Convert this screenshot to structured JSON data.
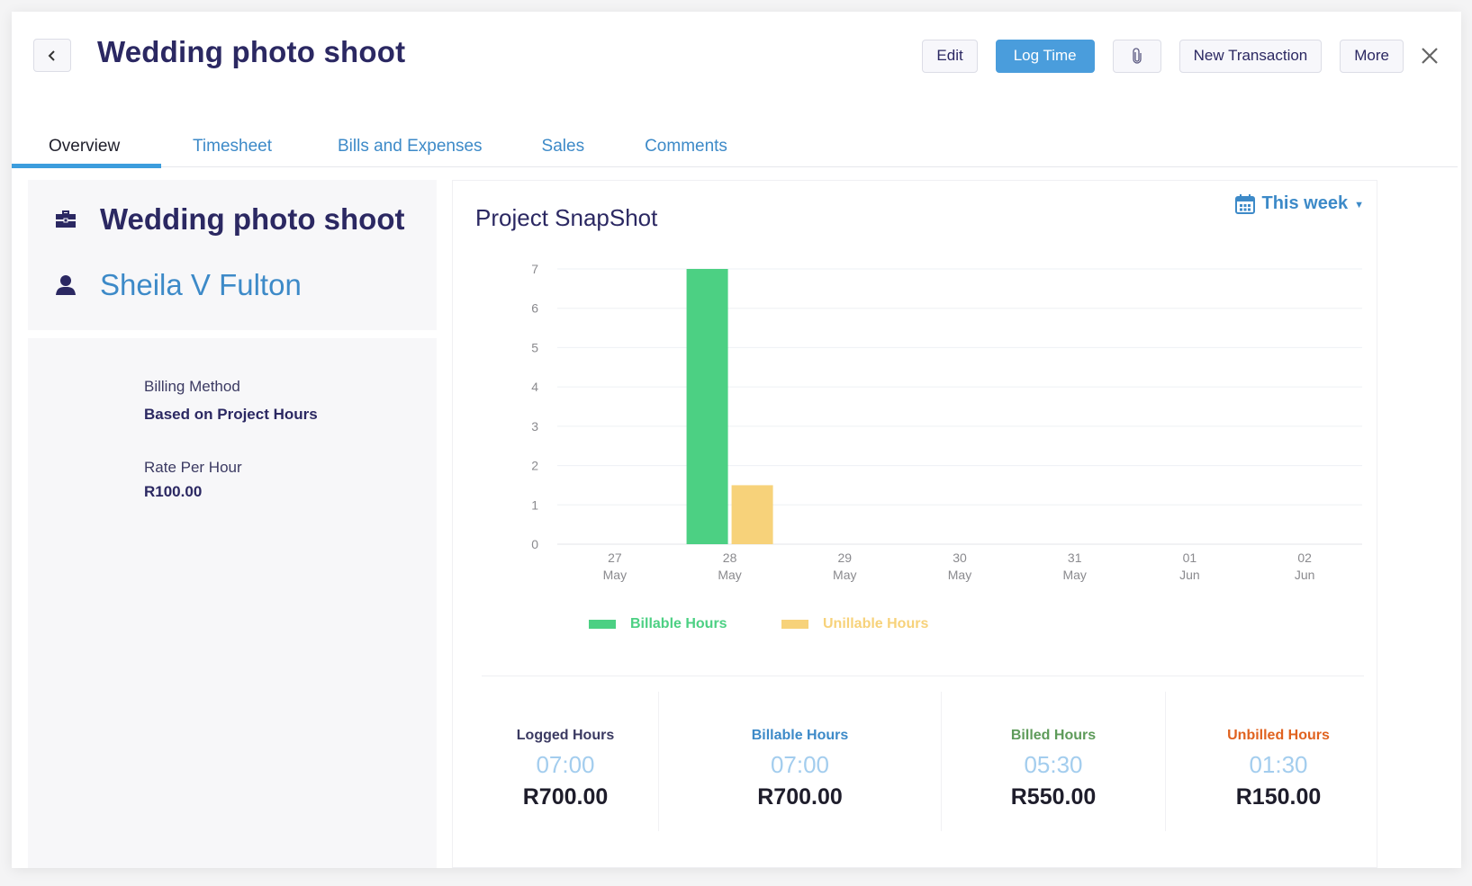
{
  "header": {
    "title": "Wedding photo shoot",
    "back_icon": "chevron-left-icon",
    "buttons": {
      "edit": "Edit",
      "log_time": "Log Time",
      "attach_icon": "paperclip-icon",
      "new_transaction": "New Transaction",
      "more": "More",
      "close_icon": "close-icon"
    }
  },
  "tabs": [
    {
      "label": "Overview",
      "active": true
    },
    {
      "label": "Timesheet",
      "active": false
    },
    {
      "label": "Bills and Expenses",
      "active": false
    },
    {
      "label": "Sales",
      "active": false
    },
    {
      "label": "Comments",
      "active": false
    }
  ],
  "project": {
    "name": "Wedding photo shoot",
    "name_icon": "briefcase-icon",
    "customer": "Sheila V Fulton",
    "customer_icon": "user-icon",
    "billing_method_label": "Billing Method",
    "billing_method_value": "Based on Project Hours",
    "rate_label": "Rate Per Hour",
    "rate_value": "R100.00"
  },
  "snapshot": {
    "title": "Project SnapShot",
    "period": "This week",
    "period_icon": "calendar-icon"
  },
  "colors": {
    "billable": "#4cd083",
    "unbillable": "#f7d27a",
    "accent": "#4a9ddc",
    "title": "#2b2862",
    "link": "#3d8ac8"
  },
  "chart_data": {
    "type": "bar",
    "title": "Project SnapShot",
    "xlabel": "",
    "ylabel": "",
    "categories": [
      "27 May",
      "28 May",
      "29 May",
      "30 May",
      "31 May",
      "01 Jun",
      "02 Jun"
    ],
    "category_lines": [
      [
        "27",
        "May"
      ],
      [
        "28",
        "May"
      ],
      [
        "29",
        "May"
      ],
      [
        "30",
        "May"
      ],
      [
        "31",
        "May"
      ],
      [
        "01",
        "Jun"
      ],
      [
        "02",
        "Jun"
      ]
    ],
    "series": [
      {
        "name": "Billable Hours",
        "values": [
          0,
          7,
          0,
          0,
          0,
          0,
          0
        ]
      },
      {
        "name": "Unillable Hours",
        "values": [
          0,
          1.5,
          0,
          0,
          0,
          0,
          0
        ]
      }
    ],
    "yticks": [
      0,
      1,
      2,
      3,
      4,
      5,
      6,
      7
    ],
    "ylim": [
      0,
      7
    ],
    "grid": true,
    "legend": "bottom-left"
  },
  "legend": {
    "billable": "Billable Hours",
    "unbillable": "Unillable Hours"
  },
  "stats": [
    {
      "label": "Logged Hours",
      "hours": "07:00",
      "amount": "R700.00",
      "color": "#3b3a62"
    },
    {
      "label": "Billable Hours",
      "hours": "07:00",
      "amount": "R700.00",
      "color": "#3d8ac8"
    },
    {
      "label": "Billed Hours",
      "hours": "05:30",
      "amount": "R550.00",
      "color": "#5e9b5a"
    },
    {
      "label": "Unbilled Hours",
      "hours": "01:30",
      "amount": "R150.00",
      "color": "#e0621f"
    }
  ]
}
